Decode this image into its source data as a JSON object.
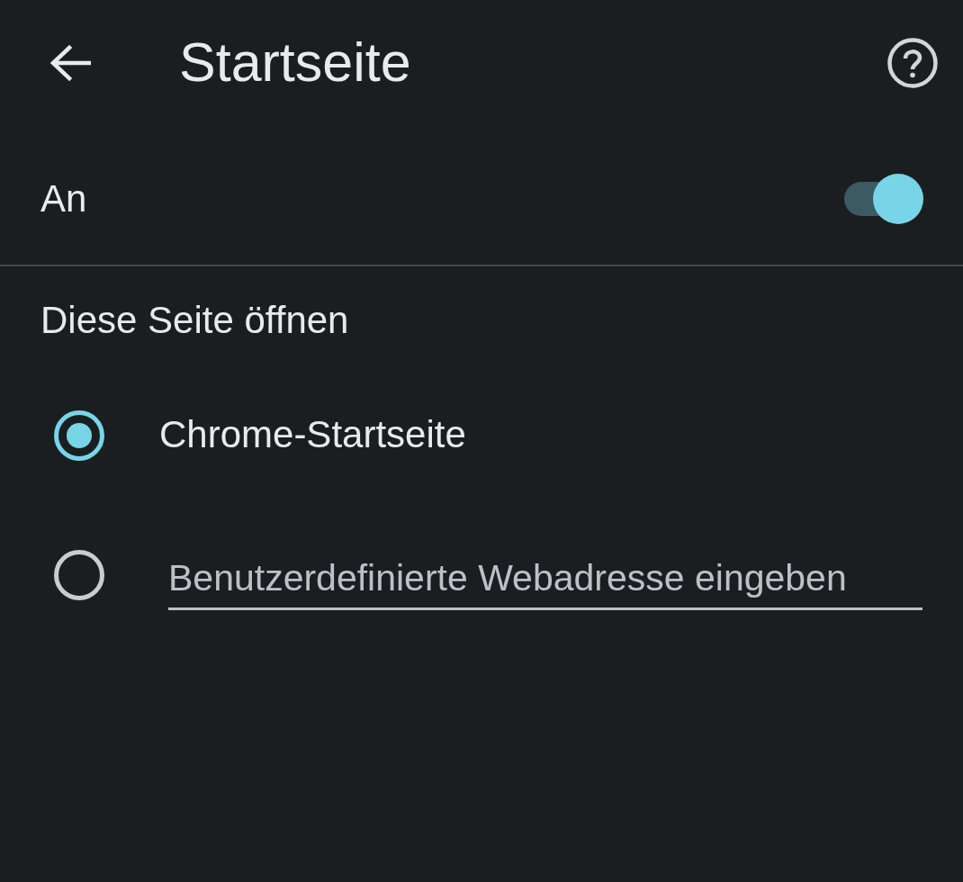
{
  "app_bar": {
    "title": "Startseite"
  },
  "main_switch": {
    "label": "An",
    "on": true
  },
  "section": {
    "heading": "Diese Seite öffnen"
  },
  "options": [
    {
      "kind": "label",
      "label": "Chrome-Startseite",
      "selected": true
    },
    {
      "kind": "field",
      "placeholder": "Benutzerdefinierte Webadresse eingeben",
      "selected": false
    }
  ]
}
